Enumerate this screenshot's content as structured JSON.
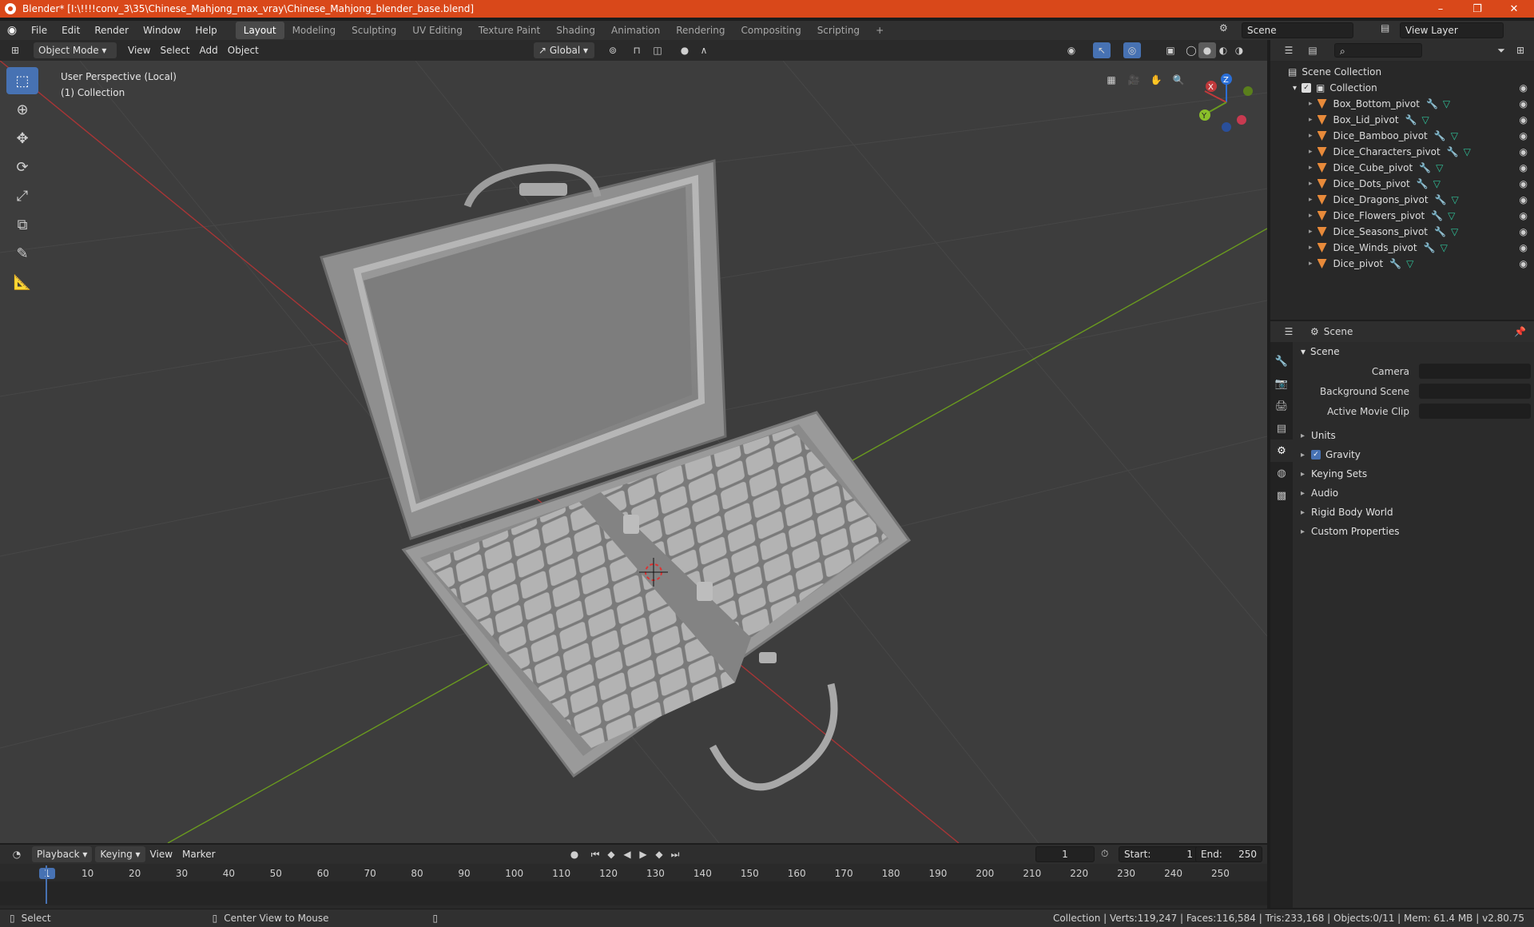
{
  "window": {
    "title": "Blender* [I:\\!!!!conv_3\\35\\Chinese_Mahjong_max_vray\\Chinese_Mahjong_blender_base.blend]",
    "controls": [
      "–",
      "❐",
      "✕"
    ]
  },
  "topbar": {
    "menus": [
      "File",
      "Edit",
      "Render",
      "Window",
      "Help"
    ],
    "workspaces": [
      "Layout",
      "Modeling",
      "Sculpting",
      "UV Editing",
      "Texture Paint",
      "Shading",
      "Animation",
      "Rendering",
      "Compositing",
      "Scripting"
    ],
    "active_workspace": "Layout",
    "add_tab": "+",
    "scene": "Scene",
    "view_layer": "View Layer"
  },
  "viewport_header": {
    "mode": "Object Mode",
    "menus": [
      "View",
      "Select",
      "Add",
      "Object"
    ],
    "orientation": "Global"
  },
  "viewport": {
    "perspective": "User Perspective (Local)",
    "collection": "(1) Collection",
    "gizmo": {
      "x": "X",
      "y": "Y",
      "z": "Z"
    },
    "colors": {
      "x_axis": "#c0393b",
      "y_axis": "#6a9a1f",
      "background": "#3d3d3d",
      "grid": "#474747"
    },
    "tools": [
      "select-box",
      "cursor",
      "move",
      "rotate",
      "scale",
      "transform",
      "annotate",
      "measure"
    ]
  },
  "outliner": {
    "search_placeholder": "",
    "root": "Scene Collection",
    "collection": "Collection",
    "items": [
      "Box_Bottom_pivot",
      "Box_Lid_pivot",
      "Dice_Bamboo_pivot",
      "Dice_Characters_pivot",
      "Dice_Cube_pivot",
      "Dice_Dots_pivot",
      "Dice_Dragons_pivot",
      "Dice_Flowers_pivot",
      "Dice_Seasons_pivot",
      "Dice_Winds_pivot",
      "Dice_pivot"
    ]
  },
  "properties": {
    "context": "Scene",
    "section": "Scene",
    "fields": [
      {
        "label": "Camera",
        "value": ""
      },
      {
        "label": "Background Scene",
        "value": ""
      },
      {
        "label": "Active Movie Clip",
        "value": ""
      }
    ],
    "subsections": [
      "Units",
      "Gravity",
      "Keying Sets",
      "Audio",
      "Rigid Body World",
      "Custom Properties"
    ],
    "gravity_checked": true
  },
  "timeline": {
    "menus": [
      "Playback",
      "Keying",
      "View",
      "Marker"
    ],
    "current_frame": "1",
    "start_label": "Start:",
    "start": "1",
    "end_label": "End:",
    "end": "250",
    "ticks": [
      "1",
      "10",
      "20",
      "30",
      "40",
      "50",
      "60",
      "70",
      "80",
      "90",
      "100",
      "110",
      "120",
      "130",
      "140",
      "150",
      "160",
      "170",
      "180",
      "190",
      "200",
      "210",
      "220",
      "230",
      "240",
      "250"
    ]
  },
  "statusbar": {
    "left": "Select",
    "middle": "Center View to Mouse",
    "right": "Collection | Verts:119,247 | Faces:116,584 | Tris:233,168 | Objects:0/11 | Mem: 61.4 MB | v2.80.75"
  }
}
